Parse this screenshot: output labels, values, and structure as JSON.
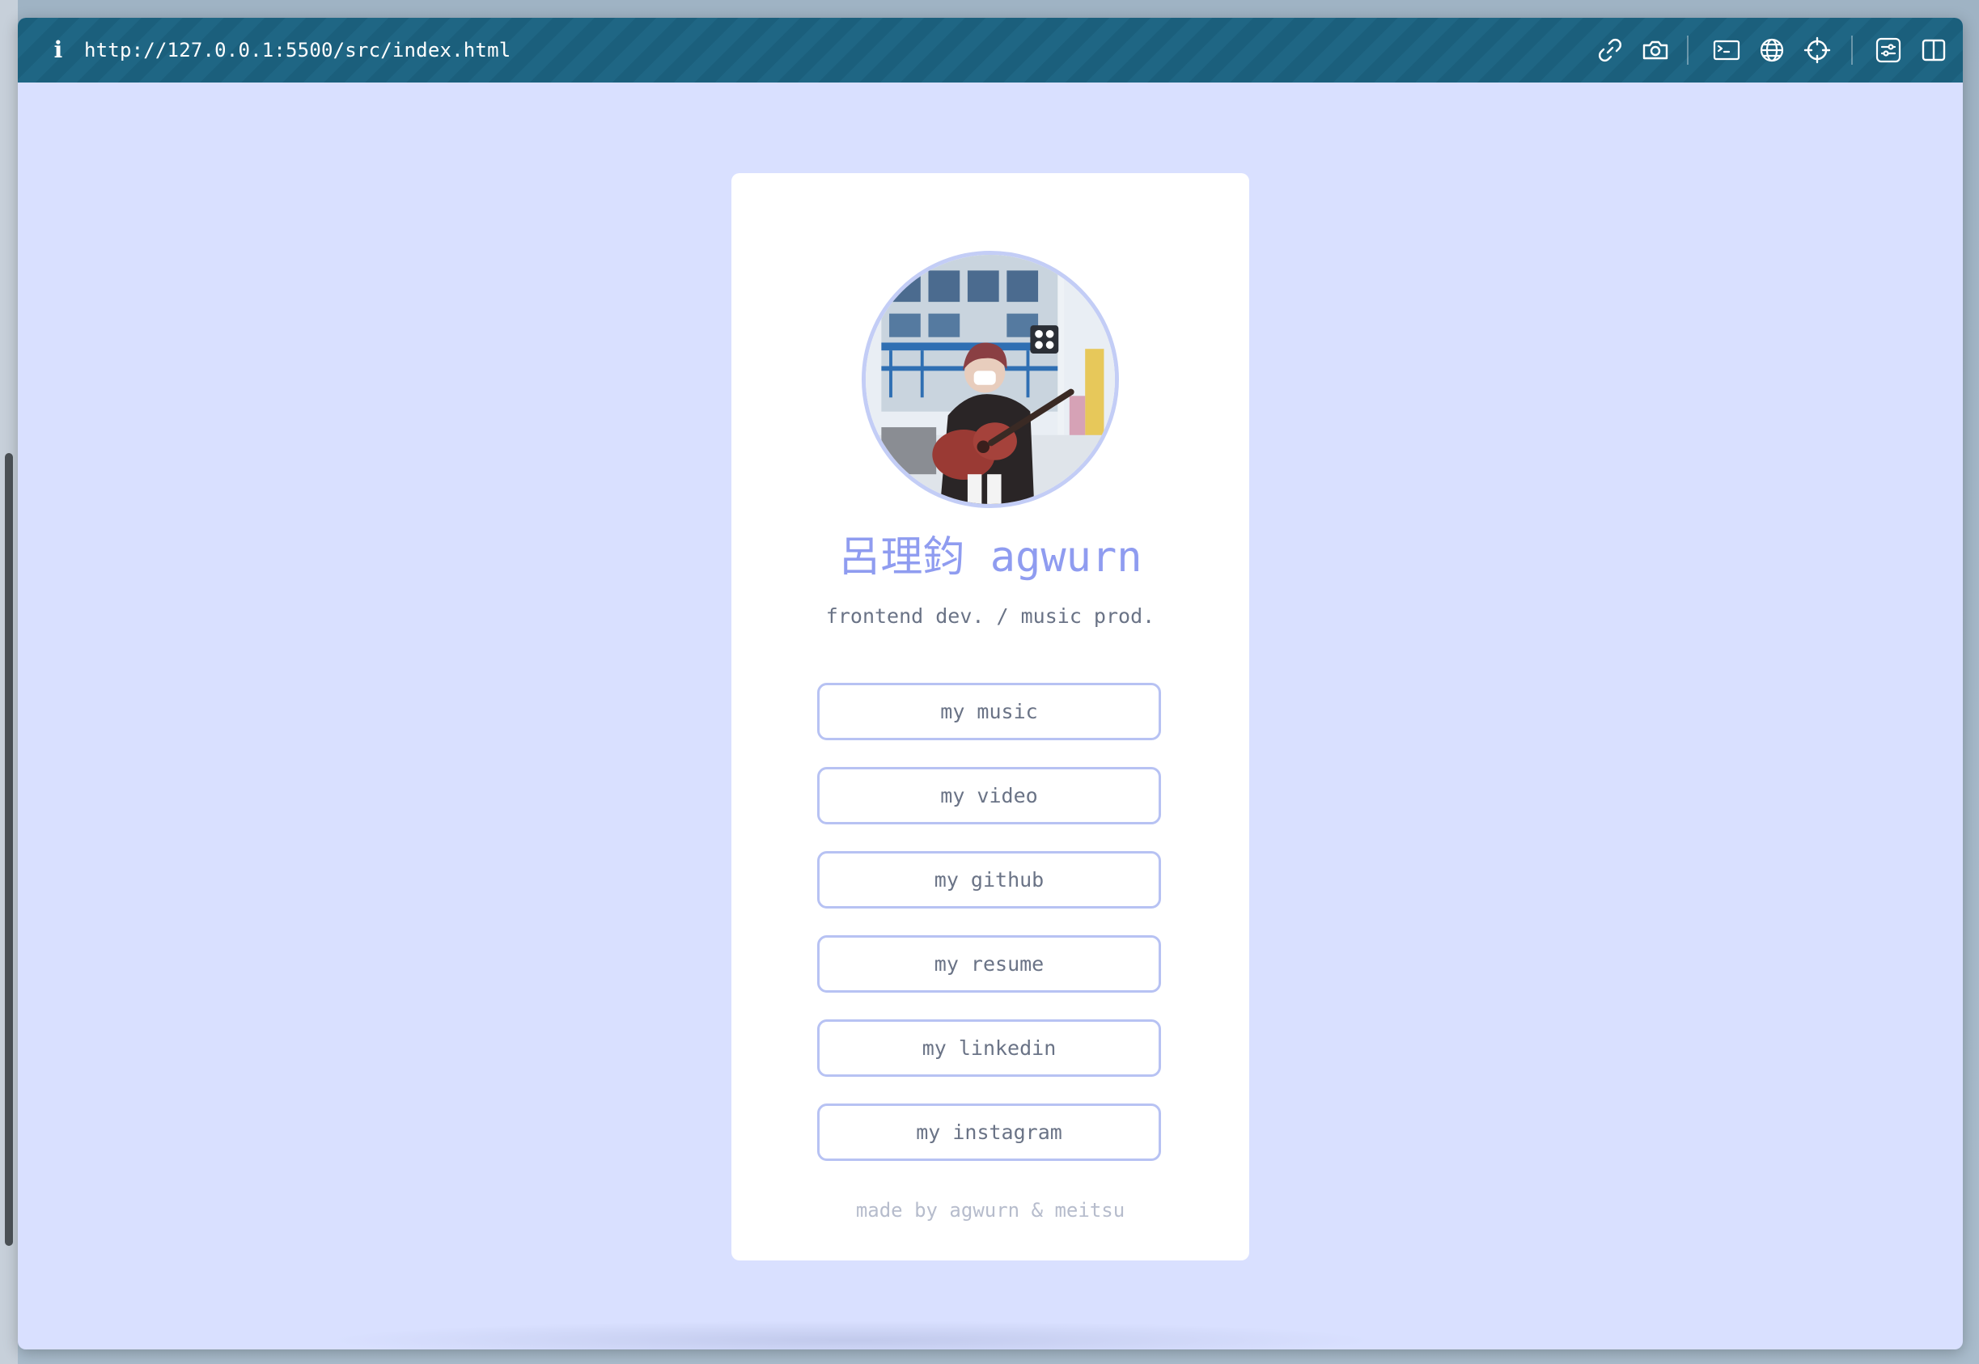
{
  "browser": {
    "url": "http://127.0.0.1:5500/src/index.html",
    "info_icon": "i",
    "toolbar_icons": [
      "link-icon",
      "camera-icon",
      "terminal-icon",
      "globe-icon",
      "crosshair-icon",
      "settings-sliders-icon",
      "split-view-icon"
    ]
  },
  "profile": {
    "name": "呂理鈞 agwurn",
    "subtitle": "frontend dev. / music prod.",
    "links": [
      {
        "label": "my music"
      },
      {
        "label": "my video"
      },
      {
        "label": "my github"
      },
      {
        "label": "my resume"
      },
      {
        "label": "my linkedin"
      },
      {
        "label": "my instagram"
      }
    ],
    "footer": "made by agwurn & meitsu"
  },
  "colors": {
    "page_background": "#d9e0ff",
    "accent": "#8f9cf0",
    "button_border": "#b7c2f3",
    "titlebar": "#1b5f7c"
  }
}
